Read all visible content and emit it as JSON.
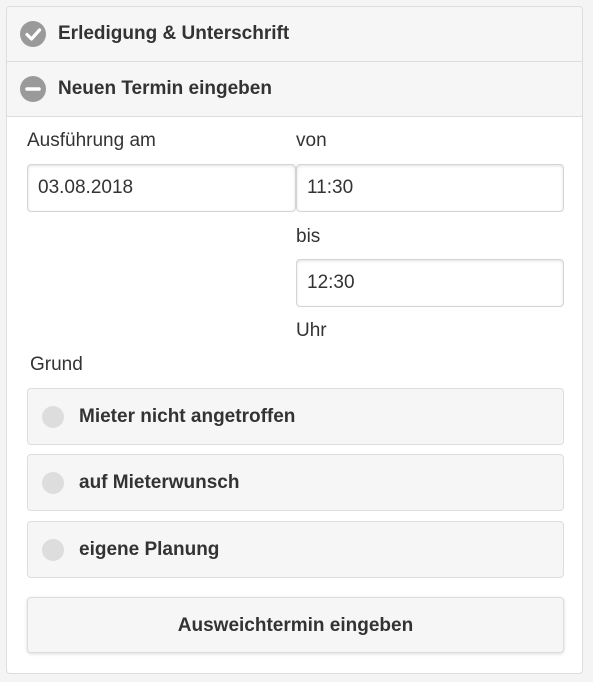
{
  "sections": {
    "completion": {
      "label": "Erledigung & Unterschrift",
      "icon": "check-circle-icon"
    },
    "new_appointment": {
      "label": "Neuen Termin eingeben",
      "icon": "minus-circle-icon"
    }
  },
  "form": {
    "date_label": "Ausführung am",
    "date_value": "03.08.2018",
    "from_label": "von",
    "from_value": "11:30",
    "to_label": "bis",
    "to_value": "12:30",
    "unit_label": "Uhr",
    "reason_label": "Grund",
    "reasons": [
      {
        "label": "Mieter nicht angetroffen"
      },
      {
        "label": "auf Mieterwunsch"
      },
      {
        "label": "eigene Planung"
      }
    ],
    "submit_label": "Ausweichtermin eingeben"
  },
  "colors": {
    "header_bg": "#f6f6f6",
    "icon_bg": "#9a9a9a",
    "border": "#dddddd",
    "text": "#333333"
  }
}
